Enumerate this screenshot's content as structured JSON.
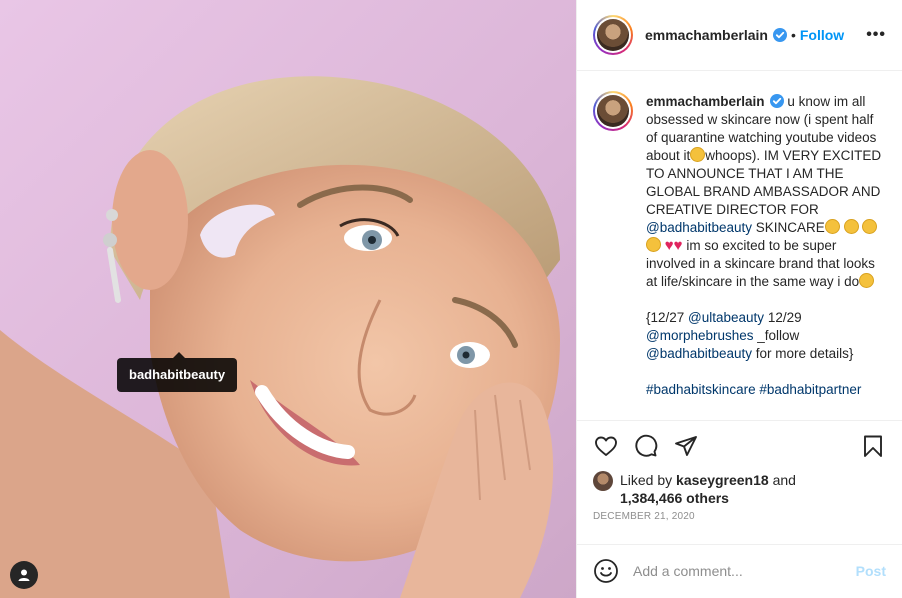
{
  "post": {
    "author": "emmachamberlain",
    "follow_label": "Follow",
    "separator": "•",
    "more_label": "•••",
    "photo_tag": "badhabitbeauty",
    "caption": {
      "p1_part1": " u know im all obsessed w skincare now (i spent half of quarantine watching youtube videos about it",
      "p1_part2": "whoops). IM VERY EXCITED TO ANNOUNCE THAT I AM THE GLOBAL BRAND AMBASSADOR AND CREATIVE DIRECTOR FOR ",
      "mention_1": "@badhabitbeauty",
      "p1_part3": " SKINCARE",
      "p1_part4": " im so excited to be super involved in a skincare brand that looks at life/skincare in the same way i do",
      "p2_part1": "{12/27 ",
      "mention_2": "@ultabeauty",
      "p2_part2": " 12/29 ",
      "mention_3": "@morphebrushes",
      "p2_part3": " _follow ",
      "mention_4": "@badhabitbeauty",
      "p2_part4": " for more details}",
      "hashtag_1": "#badhabitskincare",
      "hashtag_2": "#badhabitpartner"
    },
    "likes": {
      "prefix": "Liked by ",
      "liker": "kaseygreen18",
      "mid": " and",
      "count": "1,384,466 others"
    },
    "date": "DECEMBER 21, 2020",
    "comment": {
      "placeholder": "Add a comment...",
      "post_label": "Post"
    }
  },
  "icons": {
    "verified": "verified-badge-icon",
    "like": "heart-outline-icon",
    "comment": "comment-bubble-icon",
    "share": "paper-plane-icon",
    "save": "bookmark-icon",
    "emoji": "smiley-icon",
    "tags": "user-tag-icon"
  },
  "colors": {
    "accent": "#0095f6",
    "link": "#00376b",
    "muted": "#8e8e8e",
    "post_disabled": "#b2dffc",
    "background": "#ffffff"
  }
}
